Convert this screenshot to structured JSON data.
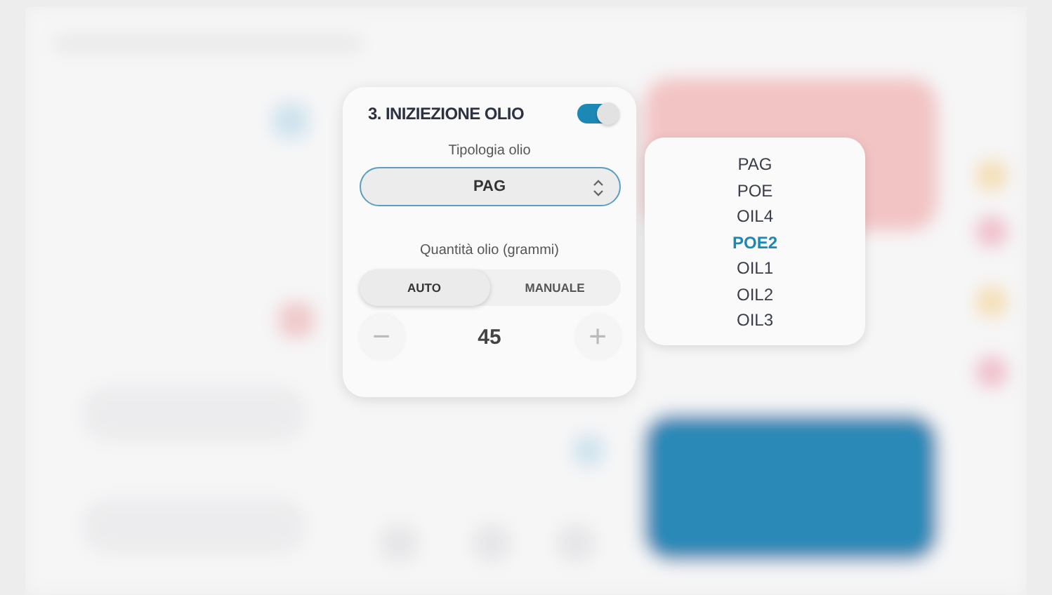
{
  "oil_card": {
    "title": "3. INIZIEZIONE OLIO",
    "enabled": true,
    "type_label": "Tipologia olio",
    "type_value": "PAG",
    "quantity_label": "Quantità olio (grammi)",
    "modes": [
      {
        "label": "AUTO",
        "selected": true
      },
      {
        "label": "MANUALE",
        "selected": false
      }
    ],
    "decrement": "−",
    "quantity": "45",
    "increment": "+"
  },
  "dropdown": {
    "options": [
      {
        "label": "PAG",
        "selected": false
      },
      {
        "label": "POE",
        "selected": false
      },
      {
        "label": "OIL4",
        "selected": false
      },
      {
        "label": "POE2",
        "selected": true
      },
      {
        "label": "OIL1",
        "selected": false
      },
      {
        "label": "OIL2",
        "selected": false
      },
      {
        "label": "OIL3",
        "selected": false
      }
    ]
  }
}
